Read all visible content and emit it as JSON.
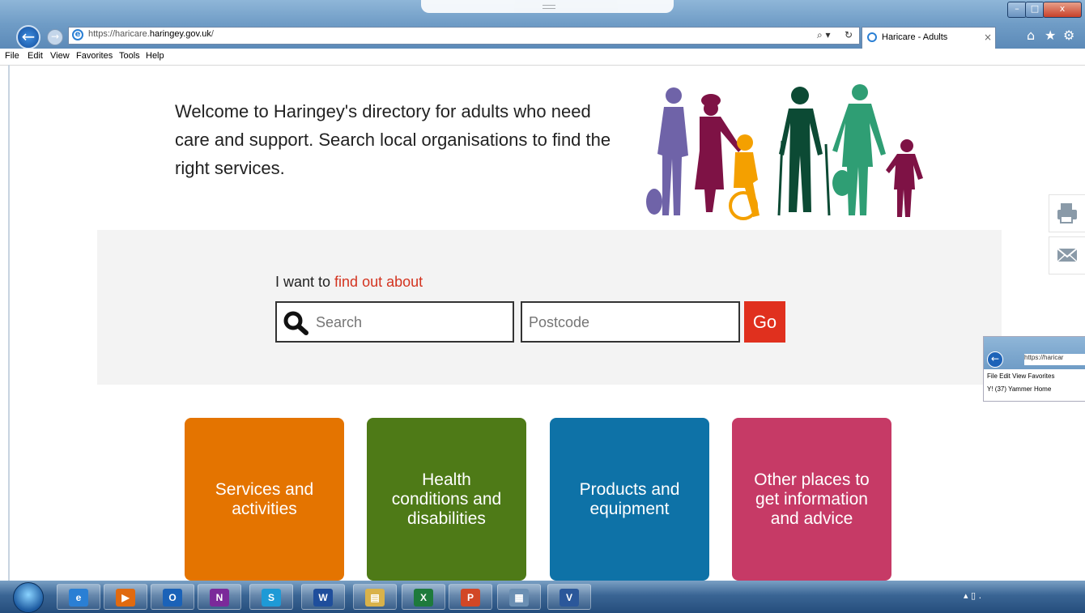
{
  "browser": {
    "url_prefix": "https://haricare.",
    "url_domain": "haringey.gov.uk",
    "url_suffix": "/",
    "tab_title": "Haricare - Adults",
    "tab_close": "×",
    "search_control": "⌕ ▾",
    "refresh_glyph": "↻",
    "window_controls": {
      "minimize": "–",
      "maximize": "□",
      "close": "x"
    },
    "toolbar_icons": {
      "home": "⌂",
      "favorites": "★",
      "tools": "⚙"
    },
    "menu": [
      "File",
      "Edit",
      "View",
      "Favorites",
      "Tools",
      "Help"
    ]
  },
  "page": {
    "welcome_text": "Welcome to Haringey's directory for adults who need care and support. Search local organisations to find the right services.",
    "search": {
      "heading_prefix": "I want to ",
      "heading_accent": "find out about",
      "search_placeholder": "Search",
      "postcode_placeholder": "Postcode",
      "go_label": "Go"
    },
    "tiles": [
      {
        "label": "Services and activities",
        "color": "#e47400"
      },
      {
        "label": "Health conditions and disabilities",
        "color": "#4e7a17"
      },
      {
        "label": "Products and equipment",
        "color": "#0e72a7"
      },
      {
        "label": "Other places to get information and advice",
        "color": "#c63a66"
      }
    ],
    "side_actions": [
      "print-icon",
      "email-icon"
    ],
    "colors": {
      "accent_red": "#e0301e",
      "panel_bg": "#f3f3f3"
    }
  },
  "thumbnail": {
    "url": "https://haricar",
    "menu": "File  Edit  View  Favorites",
    "favorites": "Y! (37) Yammer  Home"
  },
  "taskbar": {
    "apps": [
      {
        "name": "internet-explorer",
        "glyph": "e",
        "color": "#2a7fd4"
      },
      {
        "name": "media-player",
        "glyph": "▶",
        "color": "#e06a10"
      },
      {
        "name": "outlook",
        "glyph": "O",
        "color": "#1a62b8"
      },
      {
        "name": "onenote",
        "glyph": "N",
        "color": "#7b2a9a"
      },
      {
        "name": "skype",
        "glyph": "S",
        "color": "#1e9ad6"
      },
      {
        "name": "word",
        "glyph": "W",
        "color": "#1f4e9c"
      },
      {
        "name": "file-explorer",
        "glyph": "▤",
        "color": "#d9b24a"
      },
      {
        "name": "excel",
        "glyph": "X",
        "color": "#1e7a3c"
      },
      {
        "name": "powerpoint",
        "glyph": "P",
        "color": "#d24726"
      },
      {
        "name": "calculator",
        "glyph": "▦",
        "color": "#6b8fb3"
      },
      {
        "name": "visio",
        "glyph": "V",
        "color": "#2b579a"
      }
    ],
    "tray": "▴ ▯ ."
  }
}
